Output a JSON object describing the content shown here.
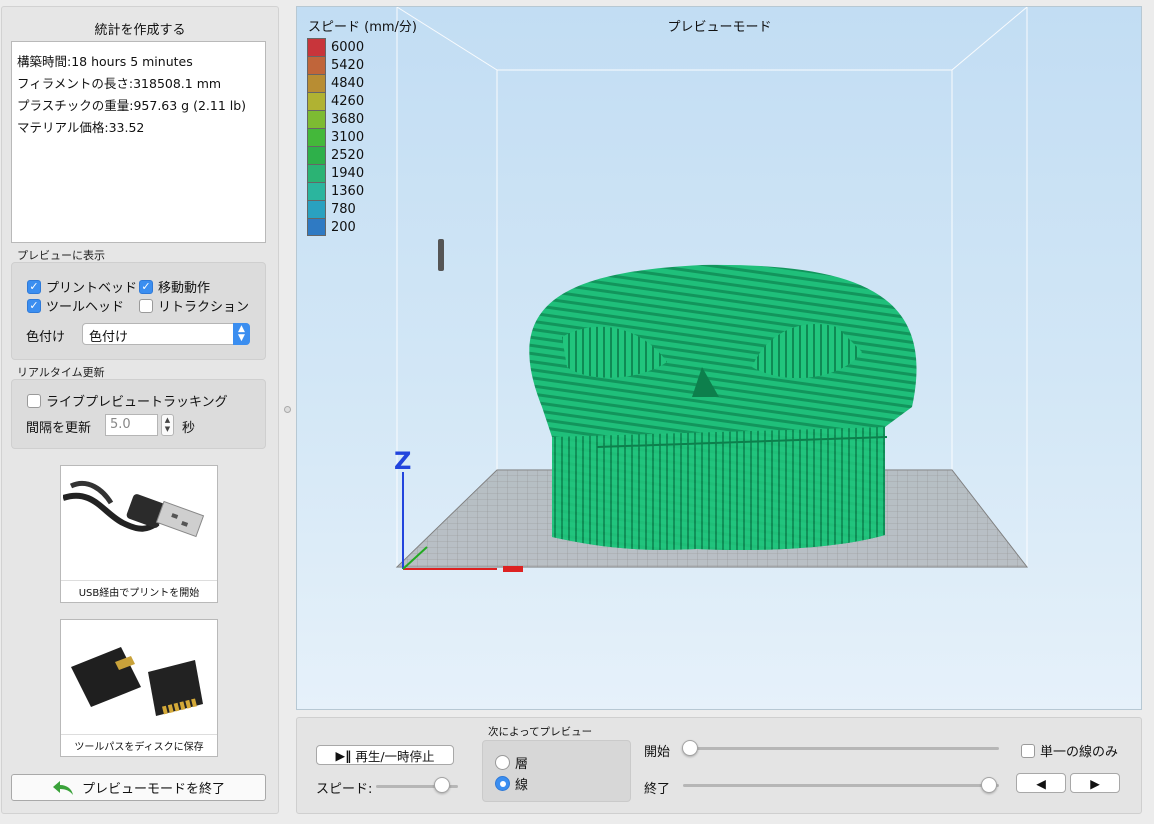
{
  "stats": {
    "title": "統計を作成する",
    "lines": [
      "構築時間:18 hours 5 minutes",
      "フィラメントの長さ:318508.1 mm",
      "プラスチックの重量:957.63 g (2.11 lb)",
      "マテリアル価格:33.52"
    ]
  },
  "preview_display": {
    "label": "プレビューに表示",
    "checkboxes": [
      {
        "label": "プリントベッド",
        "checked": true
      },
      {
        "label": "移動動作",
        "checked": true
      },
      {
        "label": "ツールヘッド",
        "checked": true
      },
      {
        "label": "リトラクション",
        "checked": false
      }
    ],
    "coloring_label": "色付け",
    "coloring_value": "色付け"
  },
  "realtime": {
    "label": "リアルタイム更新",
    "live_tracking_label": "ライブプレビュートラッキング",
    "live_tracking_checked": false,
    "interval_label": "間隔を更新",
    "interval_value": "5.0",
    "interval_unit": "秒"
  },
  "usb_button": {
    "caption": "USB経由でプリントを開始",
    "icon": "usb-cable-icon"
  },
  "sd_button": {
    "caption": "ツールパスをディスクに保存",
    "icon": "sd-card-icon"
  },
  "exit_button": {
    "label": "プレビューモードを終了",
    "icon": "back-arrow-icon",
    "icon_color": "#3aa23a"
  },
  "viewport": {
    "title": "プレビューモード",
    "axis_z_label": "Z",
    "legend": {
      "title": "スピード (mm/分)",
      "entries": [
        {
          "value": "6000",
          "color": "#c8353b"
        },
        {
          "value": "5420",
          "color": "#c0653a"
        },
        {
          "value": "4840",
          "color": "#b88d33"
        },
        {
          "value": "4260",
          "color": "#b0b232"
        },
        {
          "value": "3680",
          "color": "#7dbb32"
        },
        {
          "value": "3100",
          "color": "#44b83a"
        },
        {
          "value": "2520",
          "color": "#2eb04a"
        },
        {
          "value": "1940",
          "color": "#2bb374"
        },
        {
          "value": "1360",
          "color": "#2bb59e"
        },
        {
          "value": "780",
          "color": "#2aa1c0"
        },
        {
          "value": "200",
          "color": "#2f7ac3"
        }
      ]
    },
    "model_color": "#1fbf7a"
  },
  "controls": {
    "play_pause_label": "再生/一時停止",
    "speed_label": "スピード:",
    "speed_level": 0.8,
    "preview_by_label": "次によってプレビュー",
    "radio_layer": "層",
    "radio_line": "線",
    "selected": "線",
    "start_label": "開始",
    "start_level": 0.0,
    "end_label": "終了",
    "end_level": 1.0,
    "single_line_label": "単一の線のみ",
    "single_line_checked": false,
    "prev_icon": "triangle-left-icon",
    "next_icon": "triangle-right-icon"
  }
}
